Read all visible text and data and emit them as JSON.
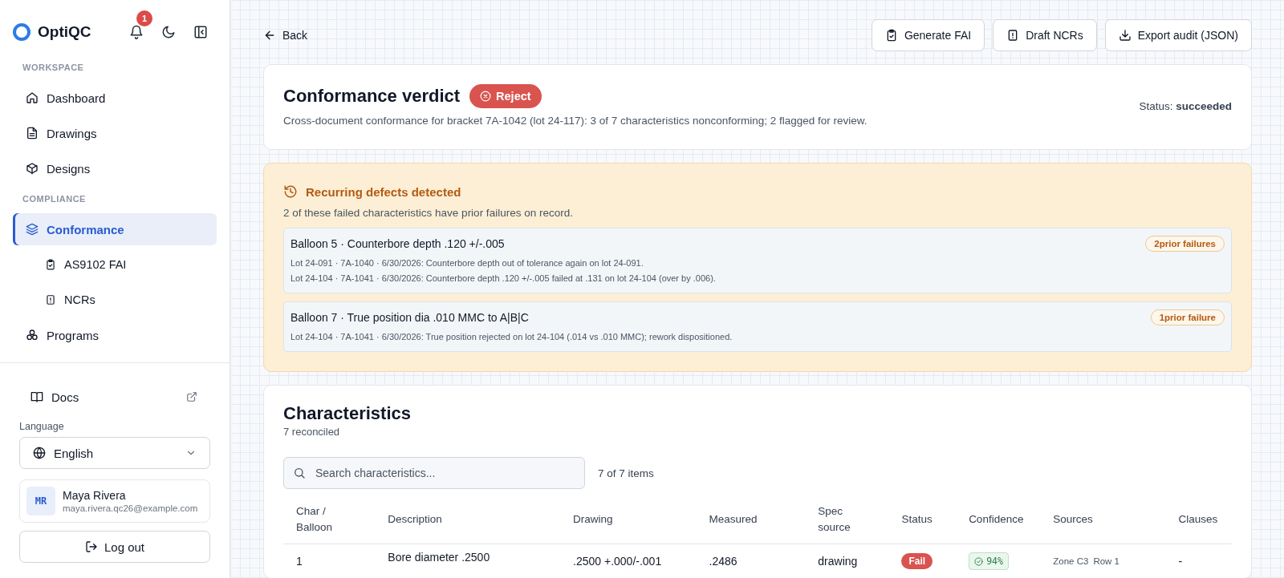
{
  "sidebar": {
    "brand": "OptiQC",
    "notifications": "1",
    "sections": [
      {
        "heading": "WORKSPACE",
        "items": [
          {
            "label": "Dashboard",
            "selected": false,
            "sub": false
          },
          {
            "label": "Drawings",
            "selected": false,
            "sub": false
          },
          {
            "label": "Designs",
            "selected": false,
            "sub": false
          }
        ]
      },
      {
        "heading": "COMPLIANCE",
        "items": [
          {
            "label": "Conformance",
            "selected": true,
            "sub": false
          },
          {
            "label": "AS9102 FAI",
            "selected": false,
            "sub": true
          },
          {
            "label": "NCRs",
            "selected": false,
            "sub": true
          },
          {
            "label": "Programs",
            "selected": false,
            "sub": false
          }
        ]
      }
    ],
    "docs": "Docs",
    "language_label": "Language",
    "language": "English",
    "user": {
      "initials": "MR",
      "name": "Maya Rivera",
      "email": "maya.rivera.qc26@example.com"
    },
    "logout": "Log out"
  },
  "toolbar": {
    "back": "Back",
    "actions": [
      {
        "label": "Generate FAI"
      },
      {
        "label": "Draft NCRs"
      },
      {
        "label": "Export audit (JSON)"
      }
    ]
  },
  "verdict": {
    "title": "Conformance verdict",
    "badge": {
      "label": "Reject",
      "kind": "reject"
    },
    "summary": "Cross-document conformance for bracket 7A-1042 (lot 24-117): 3 of 7 characteristics nonconforming; 2 flagged for review.",
    "status_label": "Status:",
    "status": "succeeded"
  },
  "recurring": {
    "title": "Recurring defects detected",
    "summary": "2 of these failed characteristics have prior failures on record.",
    "items": [
      {
        "title": "Balloon 5 · Counterbore depth .120 +/-.005",
        "badge": "2prior failures",
        "lines": [
          "Lot 24-091 · 7A-1040 · 6/30/2026: Counterbore depth out of tolerance again on lot 24-091.",
          "Lot 24-104 · 7A-1041 · 6/30/2026: Counterbore depth .120 +/-.005 failed at .131 on lot 24-104 (over by .006)."
        ]
      },
      {
        "title": "Balloon 7 · True position dia .010 MMC to A|B|C",
        "badge": "1prior failure",
        "lines": [
          "Lot 24-104 · 7A-1041 · 6/30/2026: True position rejected on lot 24-104 (.014 vs .010 MMC); rework dispositioned."
        ]
      }
    ]
  },
  "characteristics": {
    "title": "Characteristics",
    "subtitle": "7 reconciled",
    "search_placeholder": "Search characteristics...",
    "count": "7 of 7 items",
    "columns": [
      "Char / Balloon",
      "Description",
      "Drawing",
      "Measured",
      "Spec source",
      "Status",
      "Confidence",
      "Sources",
      "Clauses"
    ],
    "rows": [
      {
        "char": "1",
        "description": "Bore diameter .2500",
        "drawing": ".2500 +.000/-.001",
        "measured": ".2486",
        "spec_source": "drawing",
        "status": {
          "label": "Fail",
          "kind": "fail"
        },
        "confidence": "94%",
        "sources": [
          "Zone C3",
          "Row 1"
        ],
        "clauses": "-"
      }
    ]
  }
}
